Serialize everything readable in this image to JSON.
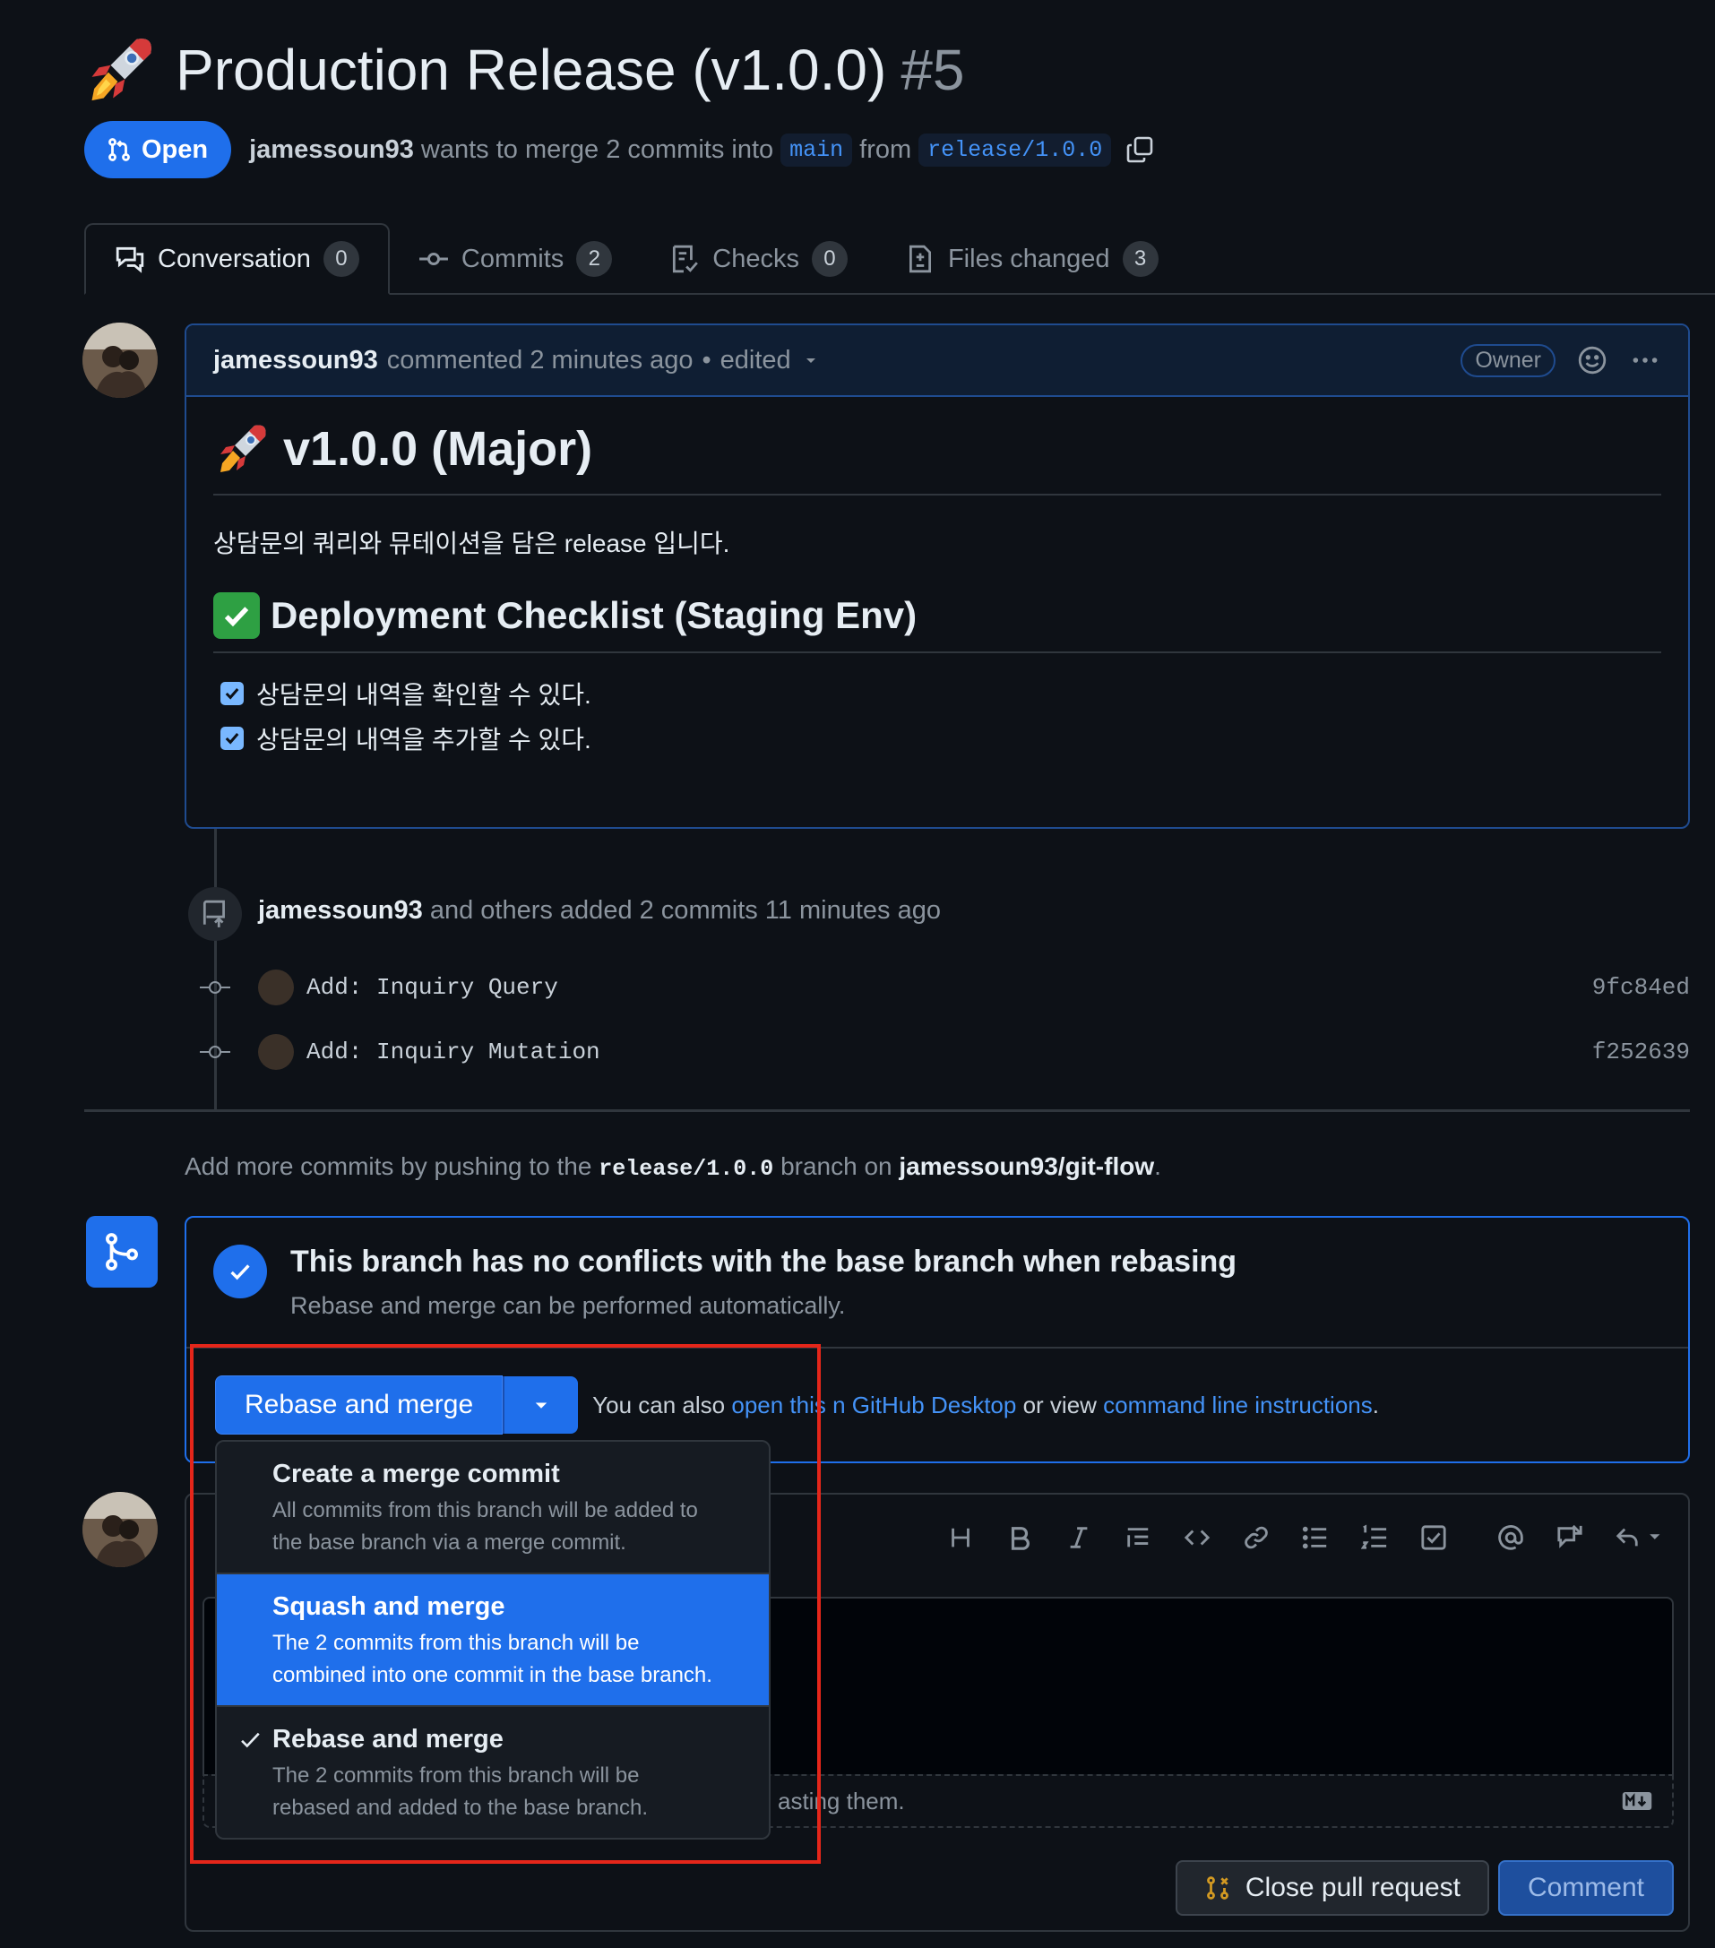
{
  "pr": {
    "title": "Production Release (v1.0.0)",
    "number": "#5",
    "state": "Open",
    "author": "jamessoun93",
    "summary": "wants to merge 2 commits into",
    "base_branch": "main",
    "from_word": "from",
    "head_branch": "release/1.0.0"
  },
  "tabs": [
    {
      "label": "Conversation",
      "count": "0",
      "icon": "conversation-icon"
    },
    {
      "label": "Commits",
      "count": "2",
      "icon": "commit-icon"
    },
    {
      "label": "Checks",
      "count": "0",
      "icon": "checklist-icon"
    },
    {
      "label": "Files changed",
      "count": "3",
      "icon": "file-diff-icon"
    }
  ],
  "comment": {
    "author": "jamessoun93",
    "meta": "commented 2 minutes ago",
    "separator": "•",
    "edited": "edited",
    "role_badge": "Owner",
    "heading": "v1.0.0 (Major)",
    "paragraph": "상담문의 쿼리와 뮤테이션을 담은 release 입니다.",
    "checklist_heading": "Deployment Checklist (Staging Env)",
    "checklist": [
      "상담문의 내역을 확인할 수 있다.",
      "상담문의 내역을 추가할 수 있다."
    ]
  },
  "commits_event": {
    "author": "jamessoun93",
    "text": "and others added 2 commits 11 minutes ago",
    "commits": [
      {
        "message": "Add: Inquiry Query",
        "sha": "9fc84ed"
      },
      {
        "message": "Add: Inquiry Mutation",
        "sha": "f252639"
      }
    ]
  },
  "hint": {
    "prefix": "Add more commits by pushing to the",
    "branch": "release/1.0.0",
    "middle": "branch on",
    "repo": "jamessoun93/git-flow",
    "suffix": "."
  },
  "merge": {
    "title": "This branch has no conflicts with the base branch when rebasing",
    "subtitle": "Rebase and merge can be performed automatically.",
    "button_label": "Rebase and merge",
    "also_prefix": "You can also",
    "open_link": "open this",
    "desktop_link": "n GitHub Desktop",
    "or_view": "or view",
    "cli_link": "command line instructions",
    "end": "."
  },
  "merge_options": [
    {
      "title": "Create a merge commit",
      "desc1": "All commits from this branch will be added to",
      "desc2": "the base branch via a merge commit.",
      "selected": false,
      "checked": false
    },
    {
      "title": "Squash and merge",
      "desc1": "The 2 commits from this branch will be",
      "desc2": "combined into one commit in the base branch.",
      "selected": true,
      "checked": false
    },
    {
      "title": "Rebase and merge",
      "desc1": "The 2 commits from this branch will be",
      "desc2": "rebased and added to the base branch.",
      "selected": false,
      "checked": true
    }
  ],
  "editor": {
    "footer_text": "asting them.",
    "close_button": "Close pull request",
    "comment_button": "Comment",
    "toolbar_icons": [
      "heading-icon",
      "bold-icon",
      "italic-icon",
      "quote-icon",
      "code-icon",
      "link-icon",
      "unordered-list-icon",
      "ordered-list-icon",
      "task-list-icon",
      "mention-icon",
      "reference-icon",
      "reply-icon"
    ]
  },
  "colors": {
    "accent": "#1f6feb",
    "link": "#4493f8",
    "highlight": "#e5261a",
    "success": "#2ea043"
  }
}
